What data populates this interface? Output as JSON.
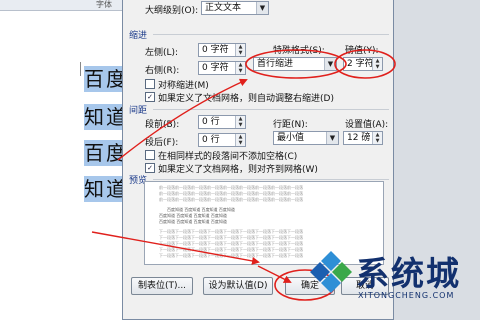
{
  "document": {
    "ruler_label": "字体",
    "lines": [
      "百度",
      "知道",
      "百度",
      "知道"
    ]
  },
  "dialog": {
    "outline_level_label": "大纲级别(O):",
    "outline_level_value": "正文文本",
    "indent_section": "缩进",
    "left_label": "左侧(L):",
    "left_value": "0 字符",
    "right_label": "右侧(R):",
    "right_value": "0 字符",
    "special_label": "特殊格式(S):",
    "special_value": "首行缩进",
    "by_label": "磅值(Y):",
    "by_value": "2 字符",
    "mirror_indent": "对称缩进(M)",
    "auto_adjust": "如果定义了文档网格，则自动调整右缩进(D)",
    "spacing_section": "间距",
    "before_label": "段前(B):",
    "before_value": "0 行",
    "after_label": "段后(F):",
    "after_value": "0 行",
    "line_spacing_label": "行距(N):",
    "line_spacing_value": "最小值",
    "at_label": "设置值(A):",
    "at_value": "12 磅",
    "no_space_same_style": "在相同样式的段落间不添加空格(C)",
    "snap_to_grid": "如果定义了文档网格，则对齐到网格(W)",
    "preview_section": "预览",
    "preview_prev": "前一段落前一段落前一段落前一段落前一段落前一段落前一段落前一段落前一段落",
    "preview_sample": "百度知道 百度知道 百度知道 百度知道",
    "preview_next": "下一段落下一段落下一段落下一段落下一段落下一段落下一段落下一段落下一段落",
    "tabs_button": "制表位(T)...",
    "default_button": "设为默认值(D)",
    "ok_button": "确定",
    "cancel_button": "取消"
  },
  "watermark": {
    "title": "系统城",
    "subtitle": "XITONGCHENG.COM"
  },
  "colors": {
    "annotation": "#e0201c",
    "selection": "#a7c7eb",
    "brand": "#12306e"
  }
}
